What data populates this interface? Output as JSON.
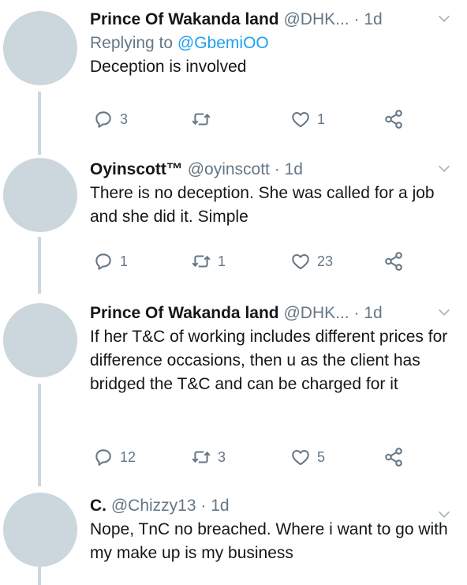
{
  "tweets": [
    {
      "name": "Prince Of Wakanda land",
      "handle": "@DHK...",
      "sep": "·",
      "time": "1d",
      "reply_prefix": "Replying to",
      "reply_mention": "@GbemiOO",
      "text": "Deception is involved",
      "replies": "3",
      "retweets": "",
      "likes": "1",
      "icons": [
        "reply-icon",
        "retweet-icon",
        "like-icon",
        "share-icon",
        "caret-down-icon"
      ]
    },
    {
      "name": "Oyinscott™",
      "handle": "@oyinscott",
      "sep": "·",
      "time": "1d",
      "text": "There is no deception. She was called for a job and she did it. Simple",
      "replies": "1",
      "retweets": "1",
      "likes": "23"
    },
    {
      "name": "Prince Of Wakanda land",
      "handle": "@DHK...",
      "sep": "·",
      "time": "1d",
      "text": "If her T&C of working includes different prices for difference occasions, then u as the client has bridged the T&C and can be charged for it",
      "replies": "12",
      "retweets": "3",
      "likes": "5"
    },
    {
      "name": "C.",
      "handle": "@Chizzy13",
      "sep": "·",
      "time": "1d",
      "text": "Nope, TnC no breached. Where i want to go with my make up is my business"
    }
  ],
  "colors": {
    "text": "#14171a",
    "secondary": "#657786",
    "link": "#1da1f2",
    "avatar": "#ccd6dd"
  }
}
